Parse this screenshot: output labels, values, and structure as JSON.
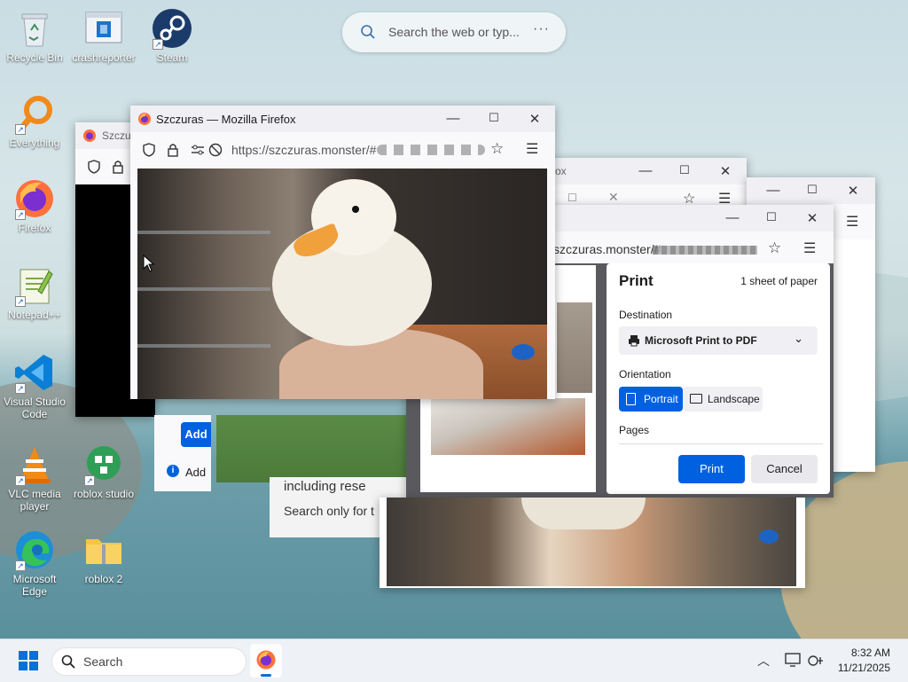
{
  "desktop": {
    "icons": [
      {
        "label": "Recycle Bin"
      },
      {
        "label": "crashreporter"
      },
      {
        "label": "Steam"
      },
      {
        "label": "Everything"
      },
      {
        "label": "Firefox"
      },
      {
        "label": "Notepad++"
      },
      {
        "label": "Visual Studio Code"
      },
      {
        "label": "VLC media player"
      },
      {
        "label": "roblox studio"
      },
      {
        "label": "Microsoft Edge"
      },
      {
        "label": "roblox 2"
      }
    ],
    "search_pill": {
      "placeholder": "Search the web or typ..."
    }
  },
  "main_window": {
    "title": "Szczuras — Mozilla Firefox",
    "url": "https://szczuras.monster/#"
  },
  "back_window": {
    "title": "Szczu",
    "snippet_add": "Add",
    "snippet_info": "Add",
    "snippet_including": "including rese",
    "snippet_search_only": "Search only for t"
  },
  "print_window": {
    "url": "szczuras.monster/#"
  },
  "print_dialog": {
    "title": "Print",
    "sheets": "1 sheet of paper",
    "destination_label": "Destination",
    "destination_value": "Microsoft Print to PDF",
    "orientation_label": "Orientation",
    "portrait_label": "Portrait",
    "landscape_label": "Landscape",
    "pages_label": "Pages",
    "print_button": "Print",
    "cancel_button": "Cancel",
    "orientation_selected": "Portrait"
  },
  "third_window": {
    "title_fragment": "ox"
  },
  "taskbar": {
    "search_label": "Search",
    "time": "8:32 AM",
    "date": "11/21/2025"
  },
  "colors": {
    "accent": "#0061e0",
    "taskbar_bg": "#eef2f6"
  }
}
